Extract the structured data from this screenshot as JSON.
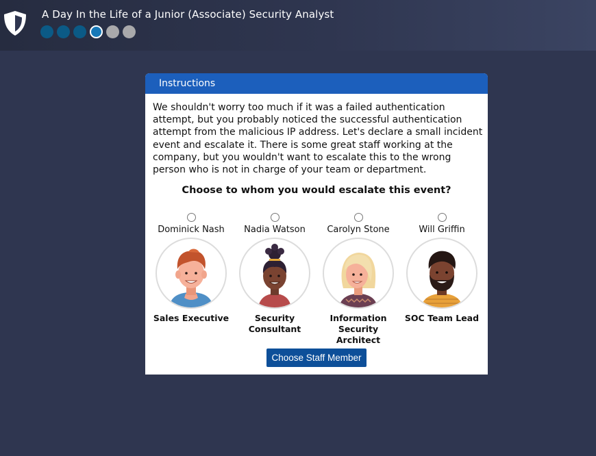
{
  "app": {
    "title": "A Day In the Life of a Junior (Associate) Security Analyst",
    "progress": {
      "total_steps": 6,
      "completed_steps": 3,
      "current_step": 4
    }
  },
  "card": {
    "header": "Instructions",
    "body": "We shouldn't worry too much if it was a failed authentication attempt, but you probably noticed the successful authentication attempt from the malicious IP address. Let's declare a small incident event and escalate it. There is some great staff working at the company, but you wouldn't want to escalate this to the wrong person who is not in charge of your team or department.",
    "question": "Choose to whom you would escalate this event?",
    "options": [
      {
        "name": "Dominick Nash",
        "role": "Sales Executive",
        "avatar_icon": "man-red-hair-avatar-icon"
      },
      {
        "name": "Nadia Watson",
        "role": "Security Consultant",
        "avatar_icon": "woman-curly-bun-avatar-icon"
      },
      {
        "name": "Carolyn Stone",
        "role": "Information Security Architect",
        "avatar_icon": "woman-blonde-avatar-icon"
      },
      {
        "name": "Will Griffin",
        "role": "SOC Team Lead",
        "avatar_icon": "man-bearded-avatar-icon"
      }
    ],
    "button_label": "Choose Staff Member"
  },
  "colors": {
    "background": "#2f3650",
    "header_blue": "#1c5fbc",
    "button_blue": "#0d4f99",
    "progress_done": "#0b5a86",
    "progress_current": "#1678b8",
    "progress_todo": "#a9a9ab"
  }
}
